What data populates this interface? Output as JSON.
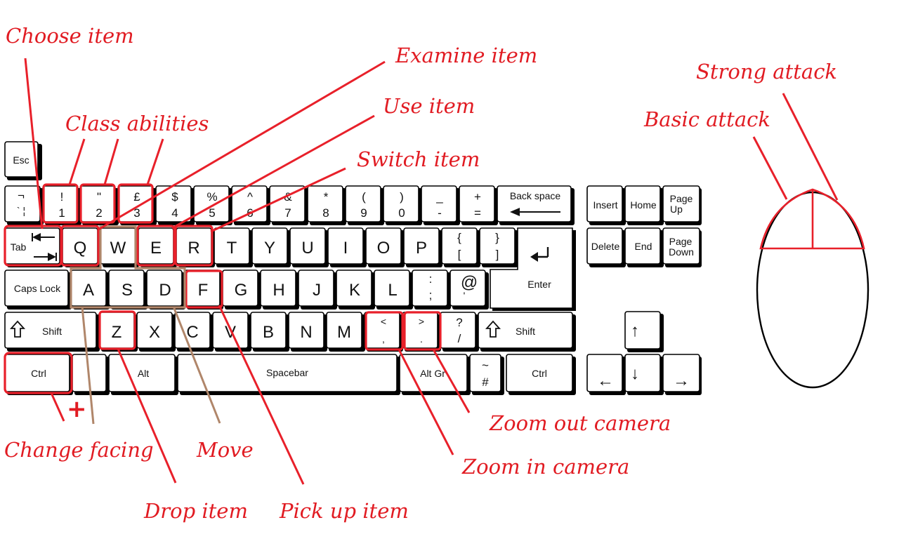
{
  "colors": {
    "annotation": "#e11b22",
    "move_group": "#b0866a",
    "key_border": "#000000"
  },
  "keyboard": {
    "esc": "Esc",
    "num_row": [
      {
        "id": "backtick",
        "top": "¬",
        "bot": "` ¦"
      },
      {
        "id": "1",
        "top": "!",
        "bot": "1"
      },
      {
        "id": "2",
        "top": "\"",
        "bot": "2"
      },
      {
        "id": "3",
        "top": "£",
        "bot": "3"
      },
      {
        "id": "4",
        "top": "$",
        "bot": "4"
      },
      {
        "id": "5",
        "top": "%",
        "bot": "5"
      },
      {
        "id": "6",
        "top": "^",
        "bot": "6"
      },
      {
        "id": "7",
        "top": "&",
        "bot": "7"
      },
      {
        "id": "8",
        "top": "*",
        "bot": "8"
      },
      {
        "id": "9",
        "top": "(",
        "bot": "9"
      },
      {
        "id": "0",
        "top": ")",
        "bot": "0"
      },
      {
        "id": "minus",
        "top": "_",
        "bot": "-"
      },
      {
        "id": "equals",
        "top": "+",
        "bot": "="
      }
    ],
    "backspace": "Back space",
    "tab": "Tab",
    "qwerty": [
      "Q",
      "W",
      "E",
      "R",
      "T",
      "Y",
      "U",
      "I",
      "O",
      "P"
    ],
    "brackets": [
      {
        "top": "{",
        "bot": "["
      },
      {
        "top": "}",
        "bot": "]"
      }
    ],
    "caps": "Caps Lock",
    "asdf": [
      "A",
      "S",
      "D",
      "F",
      "G",
      "H",
      "J",
      "K",
      "L"
    ],
    "semicolon": {
      "top": ":",
      "bot": ";"
    },
    "quote": {
      "top": "@",
      "bot": "'"
    },
    "enter": "Enter",
    "shift": "Shift",
    "zxcv": [
      "Z",
      "X",
      "C",
      "V",
      "B",
      "N",
      "M"
    ],
    "comma": {
      "top": "<",
      "bot": ","
    },
    "period": {
      "top": ">",
      "bot": "."
    },
    "slash": {
      "top": "?",
      "bot": "/"
    },
    "ctrl": "Ctrl",
    "alt": "Alt",
    "spacebar": "Spacebar",
    "altgr": "Alt Gr",
    "hash": {
      "top": "~",
      "bot": "#"
    },
    "nav": {
      "insert": "Insert",
      "home": "Home",
      "page_up": [
        "Page",
        "Up"
      ],
      "delete": "Delete",
      "end": "End",
      "page_down": [
        "Page",
        "Down"
      ]
    },
    "arrows": {
      "up": "↑",
      "left": "←",
      "down": "↓",
      "right": "→"
    }
  },
  "annotations": {
    "choose_item": "Choose item",
    "class_abilities": "Class abilities",
    "examine_item": "Examine item",
    "use_item": "Use item",
    "switch_item": "Switch item",
    "strong_attack": "Strong attack",
    "basic_attack": "Basic attack",
    "zoom_out_camera": "Zoom out camera",
    "zoom_in_camera": "Zoom in camera",
    "change_facing": "Change facing",
    "plus": "+",
    "move": "Move",
    "drop_item": "Drop item",
    "pick_up_item": "Pick up item"
  }
}
